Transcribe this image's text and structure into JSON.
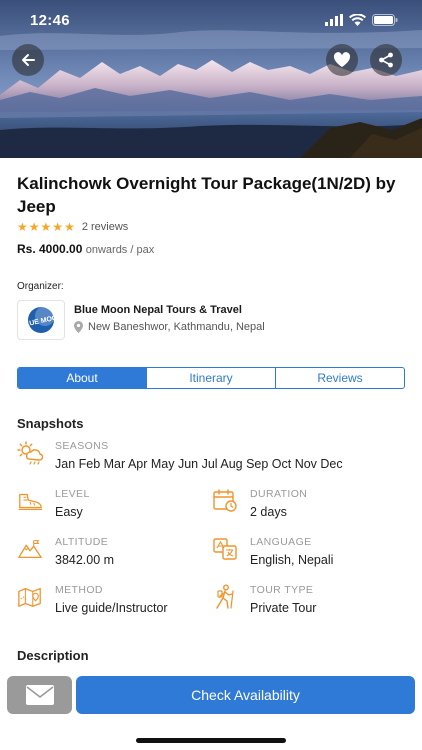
{
  "status_bar": {
    "time": "12:46"
  },
  "header": {
    "back_icon": "arrow-left-icon",
    "favorite_icon": "heart-icon",
    "share_icon": "share-icon"
  },
  "tour": {
    "title": "Kalinchowk Overnight Tour Package(1N/2D) by Jeep",
    "rating": 5,
    "reviews_label": "2 reviews",
    "price": "Rs. 4000.00",
    "price_suffix": "onwards / pax"
  },
  "organizer": {
    "label": "Organizer:",
    "name": "Blue Moon Nepal Tours & Travel",
    "address": "New Baneshwor, Kathmandu, Nepal",
    "logo_text": "BLUE MOON"
  },
  "tabs": [
    {
      "label": "About",
      "active": true
    },
    {
      "label": "Itinerary",
      "active": false
    },
    {
      "label": "Reviews",
      "active": false
    }
  ],
  "snapshots": {
    "title": "Snapshots",
    "seasons": {
      "label": "SEASONS",
      "value": "Jan Feb Mar Apr May Jun Jul Aug Sep Oct Nov Dec"
    },
    "level": {
      "label": "LEVEL",
      "value": "Easy"
    },
    "duration": {
      "label": "DURATION",
      "value": "2 days"
    },
    "altitude": {
      "label": "ALTITUDE",
      "value": "3842.00 m"
    },
    "language": {
      "label": "LANGUAGE",
      "value": "English, Nepali"
    },
    "method": {
      "label": "METHOD",
      "value": "Live guide/Instructor"
    },
    "tour_type": {
      "label": "TOUR TYPE",
      "value": "Private Tour"
    }
  },
  "description": {
    "title": "Description"
  },
  "footer": {
    "mail_icon": "envelope-icon",
    "cta_label": "Check Availability"
  },
  "colors": {
    "accent": "#2f7ad6",
    "icon_orange": "#f0932b",
    "star": "#f5a623"
  }
}
